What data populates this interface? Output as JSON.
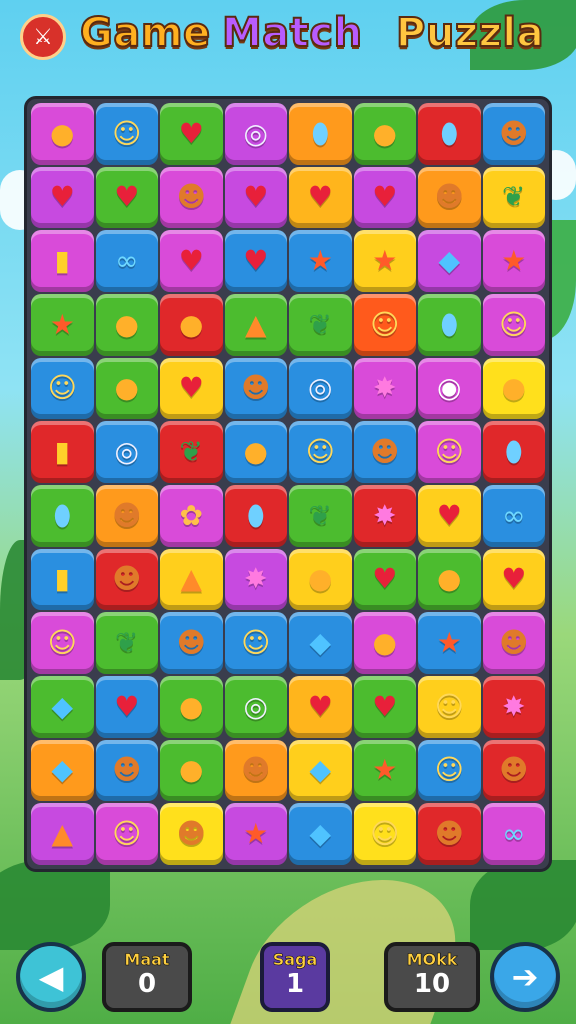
{
  "header": {
    "logo_icon": "crossed-sword-icon",
    "title_word1": "Game",
    "title_word2": "Match",
    "title_word3": "Puzzla"
  },
  "board": {
    "rows": 12,
    "cols": 8,
    "tiles": [
      [
        [
          "#d94bd9",
          "tomato-face",
          "●"
        ],
        [
          "#2a8fe0",
          "smiley-face",
          "☺"
        ],
        [
          "#4cbc2f",
          "heart",
          "♥"
        ],
        [
          "#c74ae0",
          "swirl",
          "◎"
        ],
        [
          "#ff9a1c",
          "egg",
          "⬮"
        ],
        [
          "#4cbc2f",
          "green-orb",
          "●"
        ],
        [
          "#e0282a",
          "purple-gem",
          "⬮"
        ],
        [
          "#2a8fe0",
          "orange-face",
          "☻"
        ]
      ],
      [
        [
          "#c74ae0",
          "heart",
          "♥"
        ],
        [
          "#4cbc2f",
          "pink-heart",
          "♥"
        ],
        [
          "#d94bd9",
          "cookie-face",
          "☻"
        ],
        [
          "#c74ae0",
          "heart",
          "♥"
        ],
        [
          "#ffb51c",
          "heart",
          "♥"
        ],
        [
          "#c74ae0",
          "heart",
          "♥"
        ],
        [
          "#ff9a1c",
          "chocolate-face",
          "☻"
        ],
        [
          "#ffcf1c",
          "leaf",
          "❦"
        ]
      ],
      [
        [
          "#d94bd9",
          "candy-bar",
          "▮"
        ],
        [
          "#2a8fe0",
          "pretzel",
          "∞"
        ],
        [
          "#d94bd9",
          "heart",
          "♥"
        ],
        [
          "#2a8fe0",
          "heart",
          "♥"
        ],
        [
          "#2a8fe0",
          "star",
          "★"
        ],
        [
          "#ffcf1c",
          "star",
          "★"
        ],
        [
          "#c74ae0",
          "blue-gem",
          "◆"
        ],
        [
          "#d94bd9",
          "star",
          "★"
        ]
      ],
      [
        [
          "#4cbc2f",
          "starfish",
          "★"
        ],
        [
          "#4cbc2f",
          "mango",
          "●"
        ],
        [
          "#e0282a",
          "green-blob",
          "●"
        ],
        [
          "#4cbc2f",
          "carrot",
          "▲"
        ],
        [
          "#4cbc2f",
          "leaf",
          "❦"
        ],
        [
          "#ff5a1c",
          "face",
          "☺"
        ],
        [
          "#4cbc2f",
          "green-egg",
          "⬮"
        ],
        [
          "#d94bd9",
          "smiley-face",
          "☺"
        ]
      ],
      [
        [
          "#2a8fe0",
          "cat-face",
          "☺"
        ],
        [
          "#4cbc2f",
          "orange",
          "●"
        ],
        [
          "#ffcf1c",
          "heart",
          "♥"
        ],
        [
          "#2a8fe0",
          "orange-face",
          "☻"
        ],
        [
          "#2a8fe0",
          "bubble",
          "◎"
        ],
        [
          "#d94bd9",
          "splash",
          "✸"
        ],
        [
          "#d94bd9",
          "eye",
          "◉"
        ],
        [
          "#ffe01c",
          "lemon",
          "●"
        ]
      ],
      [
        [
          "#e0282a",
          "candy-bar",
          "▮"
        ],
        [
          "#2a8fe0",
          "fish",
          "◎"
        ],
        [
          "#e0282a",
          "leaf",
          "❦"
        ],
        [
          "#2a8fe0",
          "apple",
          "●"
        ],
        [
          "#2a8fe0",
          "cat-face",
          "☺"
        ],
        [
          "#2a8fe0",
          "bear-face",
          "☻"
        ],
        [
          "#d94bd9",
          "chick-face",
          "☺"
        ],
        [
          "#e0282a",
          "purple-gem",
          "⬮"
        ]
      ],
      [
        [
          "#4cbc2f",
          "blue-gem",
          "⬮"
        ],
        [
          "#ff9a1c",
          "purple-face",
          "☻"
        ],
        [
          "#d94bd9",
          "pretzel",
          "✿"
        ],
        [
          "#e0282a",
          "blue-gem",
          "⬮"
        ],
        [
          "#4cbc2f",
          "leaf",
          "❦"
        ],
        [
          "#e0282a",
          "green-gem",
          "✸"
        ],
        [
          "#ffcf1c",
          "heart",
          "♥"
        ],
        [
          "#2a8fe0",
          "pretzel",
          "∞"
        ]
      ],
      [
        [
          "#2a8fe0",
          "pencil",
          "▮"
        ],
        [
          "#e0282a",
          "bear-face",
          "☻"
        ],
        [
          "#ffcf1c",
          "rocket",
          "▲"
        ],
        [
          "#c74ae0",
          "splash",
          "✸"
        ],
        [
          "#ffcf1c",
          "green-blob",
          "●"
        ],
        [
          "#4cbc2f",
          "heart",
          "♥"
        ],
        [
          "#4cbc2f",
          "mango",
          "●"
        ],
        [
          "#ffcf1c",
          "heart",
          "♥"
        ]
      ],
      [
        [
          "#d94bd9",
          "smiley-face",
          "☺"
        ],
        [
          "#4cbc2f",
          "banana",
          "❦"
        ],
        [
          "#2a8fe0",
          "cat-face",
          "☻"
        ],
        [
          "#2a8fe0",
          "bear-face",
          "☺"
        ],
        [
          "#2a8fe0",
          "pink-gem",
          "◆"
        ],
        [
          "#d94bd9",
          "tomato",
          "●"
        ],
        [
          "#2a8fe0",
          "star",
          "★"
        ],
        [
          "#d94bd9",
          "chocolate-face",
          "☻"
        ]
      ],
      [
        [
          "#4cbc2f",
          "pink-gem",
          "◆"
        ],
        [
          "#2a8fe0",
          "heart",
          "♥"
        ],
        [
          "#4cbc2f",
          "lime",
          "●"
        ],
        [
          "#4cbc2f",
          "purple-orb",
          "◎"
        ],
        [
          "#ffb51c",
          "heart",
          "♥"
        ],
        [
          "#4cbc2f",
          "heart",
          "♥"
        ],
        [
          "#ffcf1c",
          "cat-face",
          "☺"
        ],
        [
          "#e0282a",
          "sun",
          "✸"
        ]
      ],
      [
        [
          "#ff9a1c",
          "tomato",
          "◆"
        ],
        [
          "#2a8fe0",
          "orange-face",
          "☻"
        ],
        [
          "#4cbc2f",
          "carrot",
          "●"
        ],
        [
          "#ff9a1c",
          "bear-face",
          "☻"
        ],
        [
          "#ffcf1c",
          "blue-gem",
          "◆"
        ],
        [
          "#4cbc2f",
          "star",
          "★"
        ],
        [
          "#2a8fe0",
          "smiley-face",
          "☺"
        ],
        [
          "#e0282a",
          "purple-face",
          "☻"
        ]
      ],
      [
        [
          "#c74ae0",
          "carrot",
          "▲"
        ],
        [
          "#d94bd9",
          "smiley-face",
          "☺"
        ],
        [
          "#ffe01c",
          "chocolate-face",
          "☻"
        ],
        [
          "#c74ae0",
          "starfish",
          "★"
        ],
        [
          "#2a8fe0",
          "diamond",
          "◆"
        ],
        [
          "#ffe01c",
          "green-face",
          "☺"
        ],
        [
          "#e0282a",
          "bear-face",
          "☻"
        ],
        [
          "#d94bd9",
          "pretzel",
          "∞"
        ]
      ]
    ]
  },
  "footer": {
    "back_icon": "back-arrow-icon",
    "next_icon": "next-arrow-icon",
    "stat1_label": "Maat",
    "stat1_value": "0",
    "stat2_label": "Saga",
    "stat2_value": "1",
    "stat3_label": "MOkk",
    "stat3_value": "10"
  }
}
